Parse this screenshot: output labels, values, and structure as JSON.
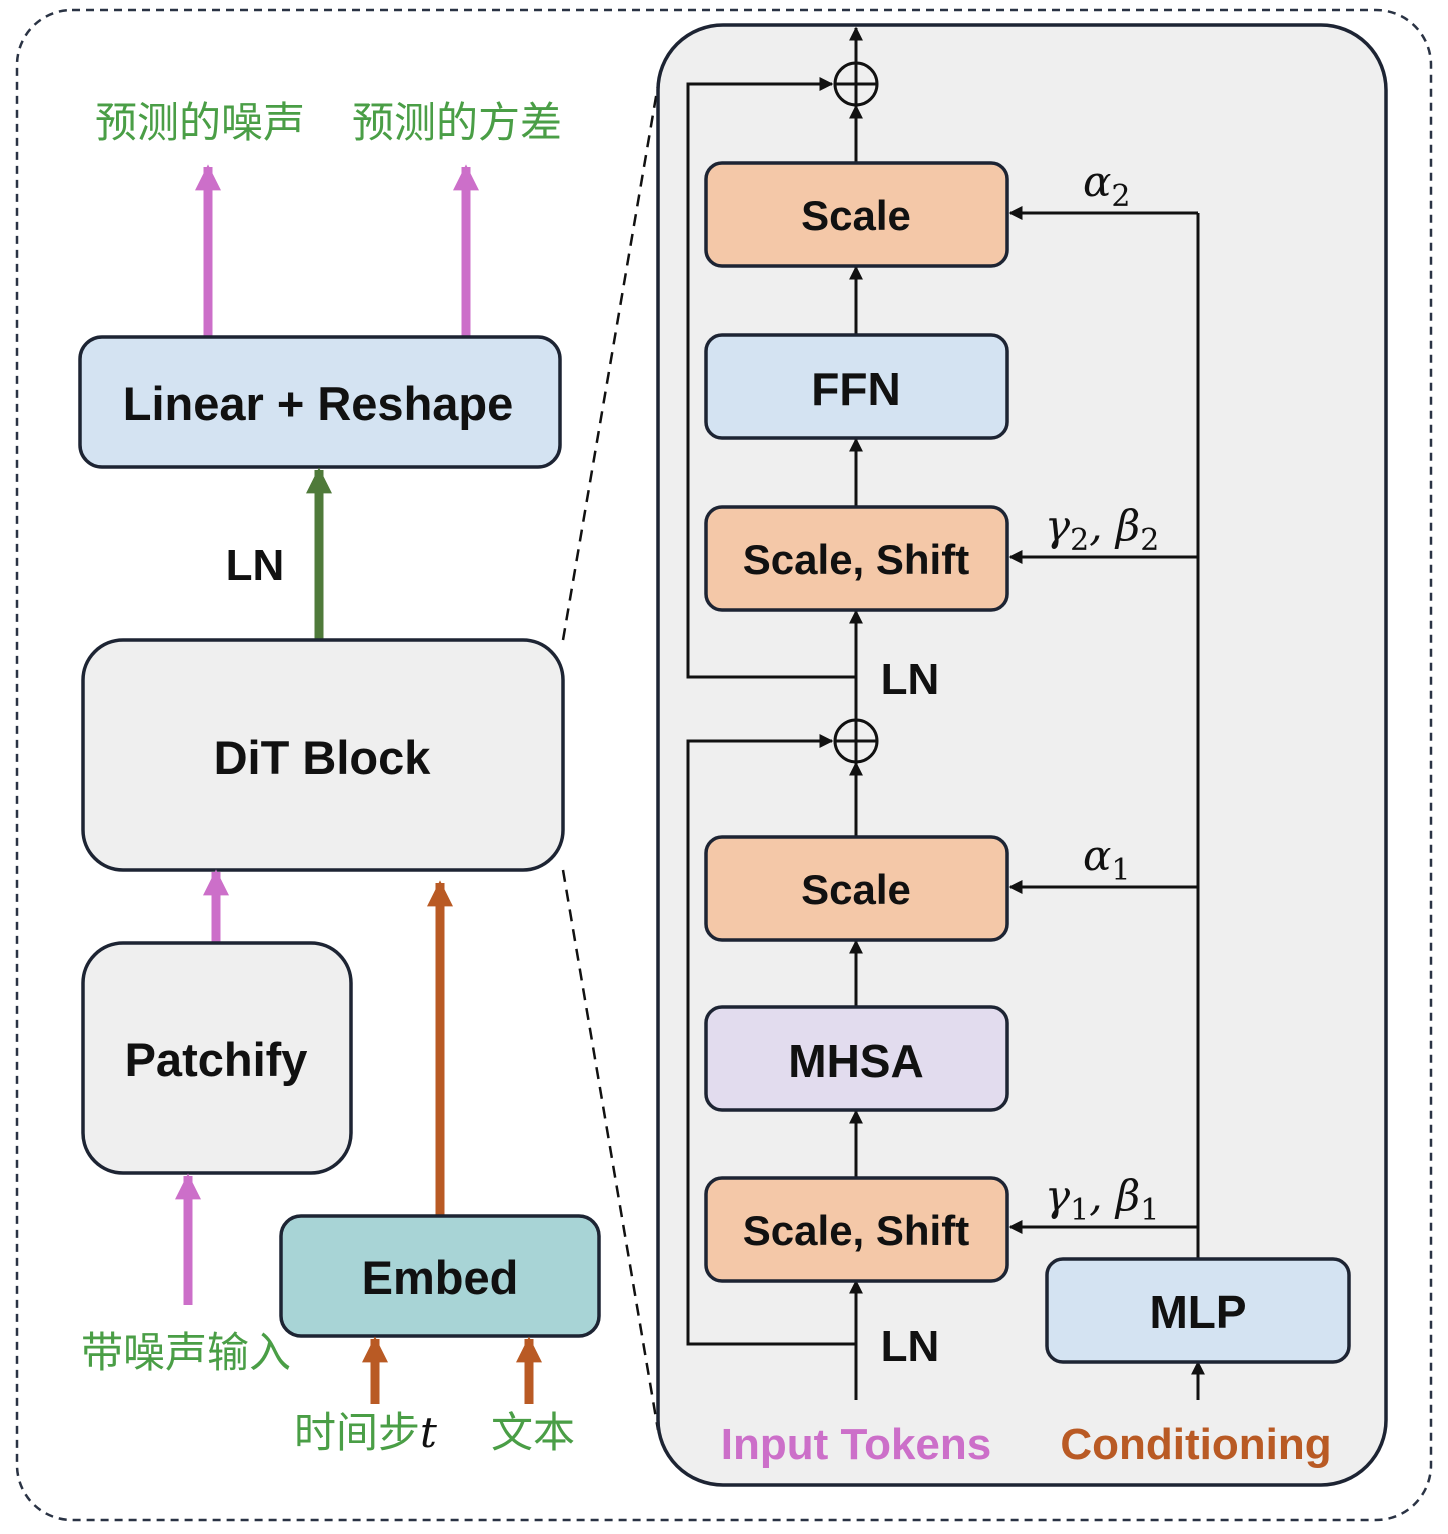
{
  "outputs": {
    "noise": "预测的噪声",
    "variance": "预测的方差"
  },
  "left": {
    "linear_reshape": "Linear + Reshape",
    "ln": "LN",
    "dit_block": "DiT Block",
    "patchify": "Patchify",
    "embed": "Embed",
    "noisy_input": "带噪声输入",
    "timestep": "时间步",
    "timestep_var": "t",
    "text": "文本"
  },
  "block": {
    "scale_top": "Scale",
    "ffn": "FFN",
    "scale_shift_top": "Scale, Shift",
    "ln_mid": "LN",
    "scale_bottom": "Scale",
    "mhsa": "MHSA",
    "scale_shift_bottom": "Scale, Shift",
    "ln_bottom": "LN",
    "mlp": "MLP",
    "input_tokens": "Input Tokens",
    "conditioning": "Conditioning",
    "alpha2": {
      "sym": "α",
      "sub": "2"
    },
    "gamma2": {
      "sym1": "γ",
      "sub1": "2",
      "sep": ", ",
      "sym2": "β",
      "sub2": "2"
    },
    "alpha1": {
      "sym": "α",
      "sub": "1"
    },
    "gamma1": {
      "sym1": "γ",
      "sub1": "1",
      "sep": ", ",
      "sym2": "β",
      "sub2": "1"
    }
  },
  "colors": {
    "pink": "#cc6fc9",
    "green_arrow": "#4f7a3a",
    "orange_arrow": "#b95a24",
    "green_text": "#4a9e46",
    "input_tokens_text": "#cc6fc9",
    "conditioning_text": "#b95a24",
    "box_blue": "#d4e3f2",
    "box_gray": "#efefef",
    "box_teal": "#a8d4d6",
    "box_orange": "#f4c8a8",
    "box_purple": "#e2dcee",
    "panel": "#efefef"
  }
}
